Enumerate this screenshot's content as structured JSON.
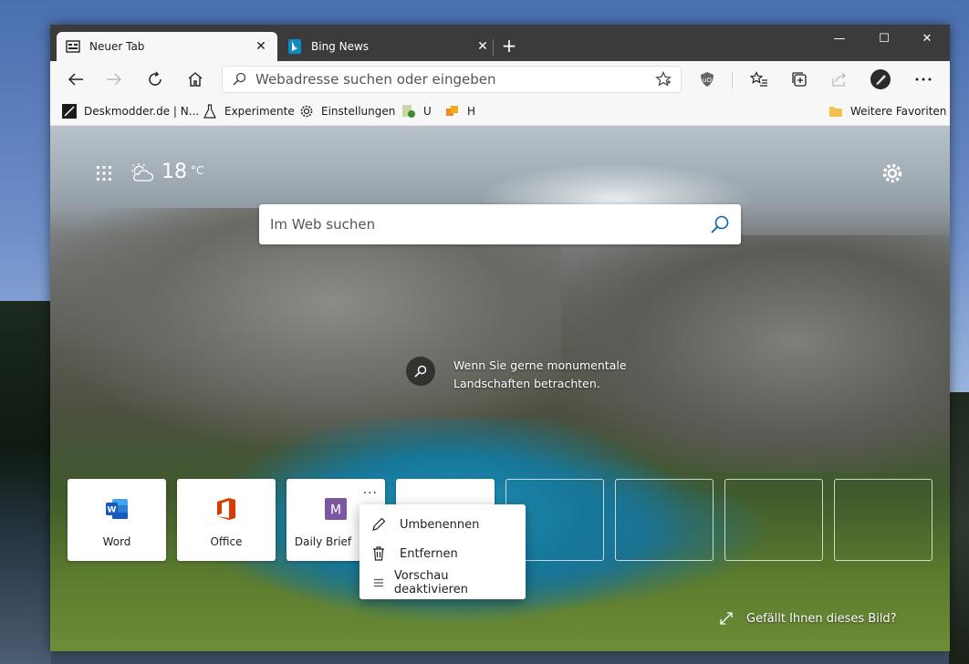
{
  "tabs": [
    {
      "label": "Neuer Tab",
      "icon": "newtab-icon",
      "active": true
    },
    {
      "label": "Bing News",
      "icon": "bing-icon",
      "active": false
    }
  ],
  "new_tab_symbol": "+",
  "window_controls": {
    "minimize": "—",
    "maximize": "☐",
    "close": "✕"
  },
  "tab_close_symbol": "✕",
  "address_bar": {
    "placeholder": "Webadresse suchen oder eingeben"
  },
  "favorites": [
    {
      "label": "Deskmodder.de | N...",
      "icon": "deskmodder-icon"
    },
    {
      "label": "Experimente",
      "icon": "flask-icon"
    },
    {
      "label": "Einstellungen",
      "icon": "gear-icon"
    },
    {
      "label": "U",
      "icon": "extension-u-icon"
    },
    {
      "label": "H",
      "icon": "extension-h-icon"
    },
    {
      "label": "Weitere Favoriten",
      "icon": "folder-icon"
    }
  ],
  "weather": {
    "temp": "18",
    "unit": "°C"
  },
  "search": {
    "placeholder": "Im Web suchen"
  },
  "image_info": {
    "text": "Wenn Sie gerne monumentale Landschaften betrachten."
  },
  "quick_links": [
    {
      "label": "Word",
      "icon": "word-icon"
    },
    {
      "label": "Office",
      "icon": "office-icon"
    },
    {
      "label": "Daily Brief",
      "icon": "daily-brief-icon",
      "more": "..."
    }
  ],
  "context_menu": [
    {
      "label": "Umbenennen",
      "icon": "pencil-icon"
    },
    {
      "label": "Entfernen",
      "icon": "trash-icon"
    },
    {
      "label": "Vorschau deaktivieren",
      "icon": "list-icon"
    }
  ],
  "like_prompt": "Gefällt Ihnen dieses Bild?",
  "colors": {
    "word_blue": "#185abd",
    "office_red": "#d83b01",
    "daily_brief_purple": "#7b57a0",
    "accent": "#0a63b1"
  }
}
